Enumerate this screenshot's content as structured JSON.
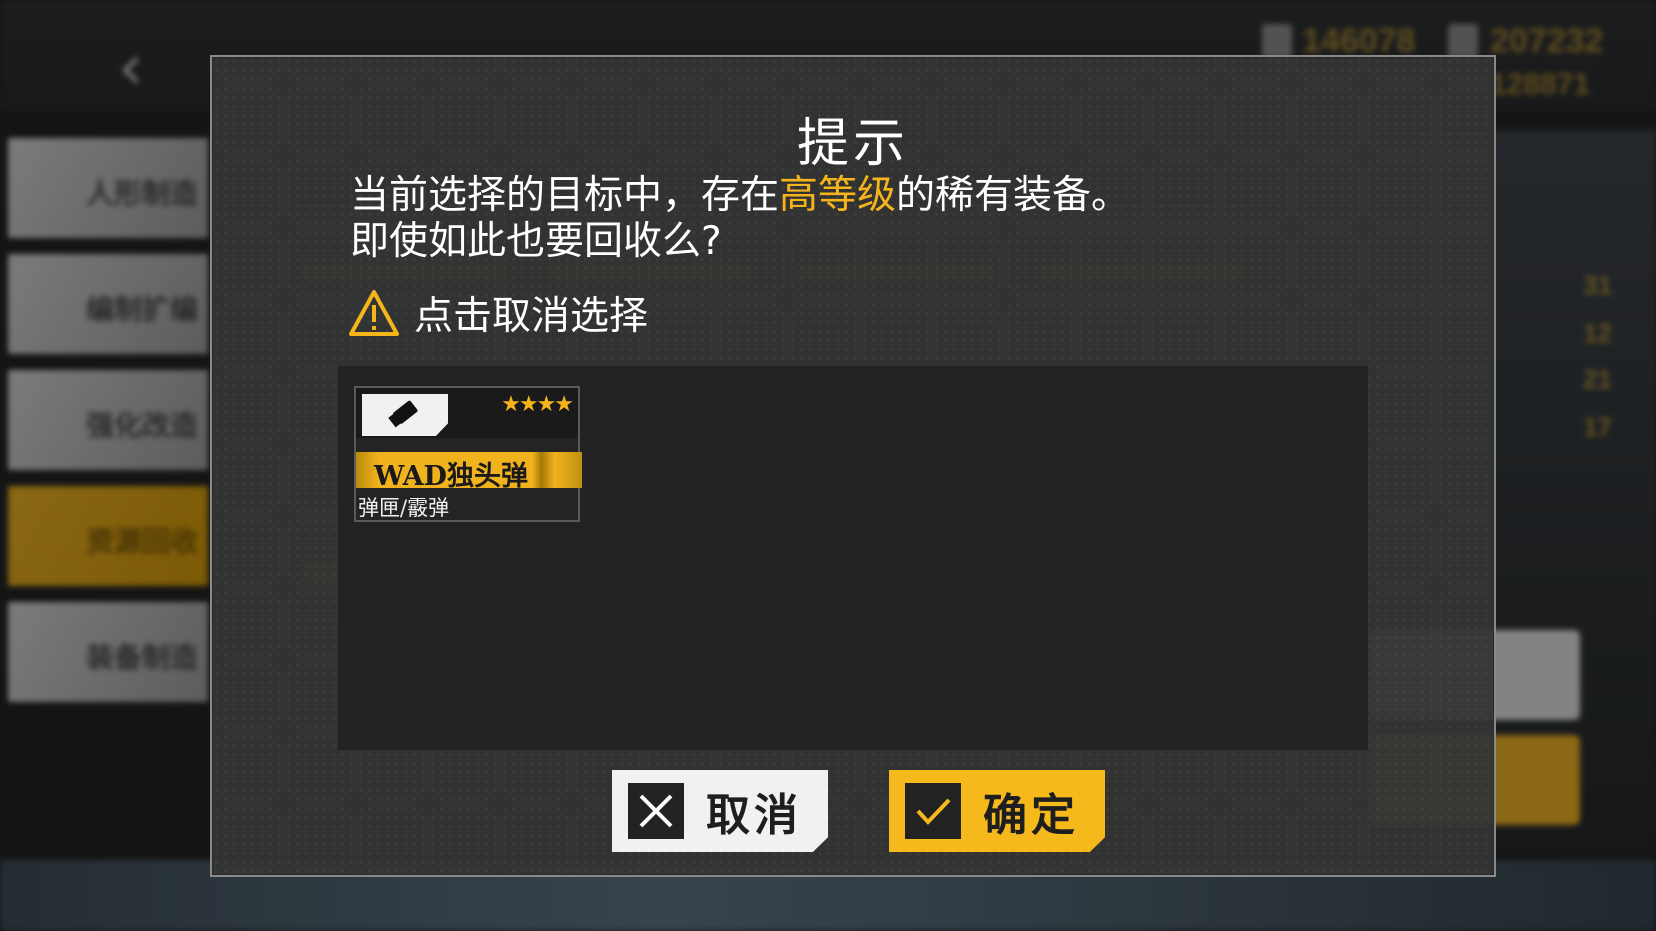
{
  "background": {
    "back_arrow": "‹",
    "resources": [
      "146078",
      "207232",
      "128871"
    ],
    "side_menu": [
      "人形制造",
      "编制扩编",
      "强化改造",
      "资源回收",
      "装备制造"
    ],
    "active_menu_index": 3,
    "right_numbers": [
      "31",
      "12",
      "21",
      "17"
    ]
  },
  "dialog": {
    "title": "提示",
    "message_part1": "当前选择的目标中，存在",
    "message_highlight": "高等级",
    "message_part2": "的稀有装备。",
    "message_line2": "即使如此也要回收么?",
    "hint": "点击取消选择",
    "hint_icon": "warning-icon",
    "equipment": {
      "name": "WAD独头弹",
      "type": "弹匣/霰弹",
      "stars": "★★★★",
      "icon": "shotgun-shell-icon"
    },
    "cancel_label": "取消",
    "confirm_label": "确定"
  },
  "colors": {
    "accent": "#f5b51a",
    "dialog_bg": "#343434",
    "cancel_bg": "#f1f1f1",
    "confirm_bg": "#f5b91b"
  }
}
